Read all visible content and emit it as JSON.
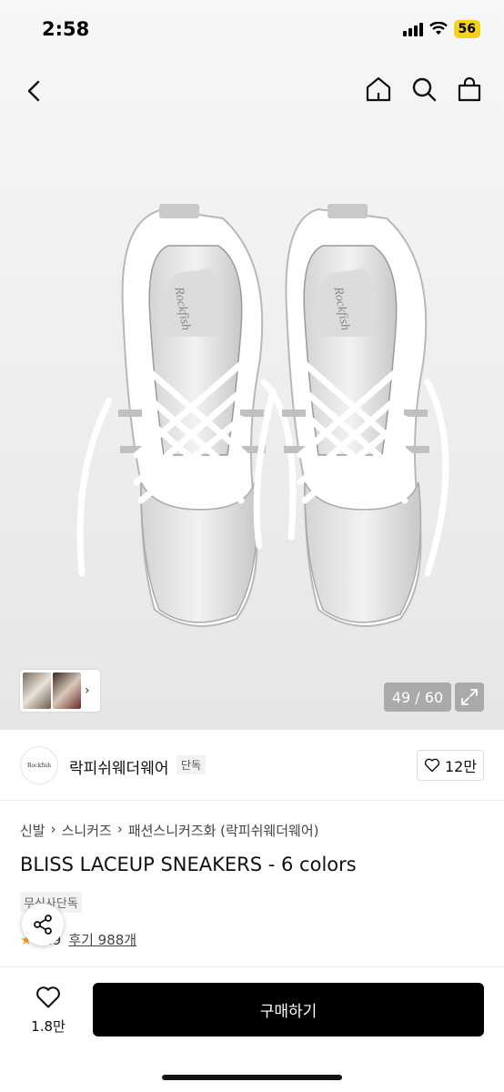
{
  "status_bar": {
    "time": "2:58",
    "battery": "56"
  },
  "gallery": {
    "counter": "49 / 60",
    "shoe_logo_text": "Rockfish"
  },
  "brand": {
    "logo_text": "Rockfish",
    "name": "락피쉬웨더웨어",
    "badge": "단독",
    "like_count": "12만"
  },
  "breadcrumb": [
    "신발",
    "스니커즈",
    "패션스니커즈화 (락피쉬웨더웨어)"
  ],
  "product": {
    "title": "BLISS LACEUP SNEAKERS - 6 colors",
    "tag": "무신사단독",
    "rating": "4.9",
    "review_label": "후기 988개"
  },
  "bottom": {
    "wish_count": "1.8만",
    "buy_label": "구매하기"
  },
  "colors": {
    "accent": "#000000",
    "battery": "#f5d21a"
  },
  "icons": [
    "back-icon",
    "home-icon",
    "search-icon",
    "bag-icon",
    "expand-icon",
    "heart-icon",
    "share-icon",
    "star-icon"
  ]
}
